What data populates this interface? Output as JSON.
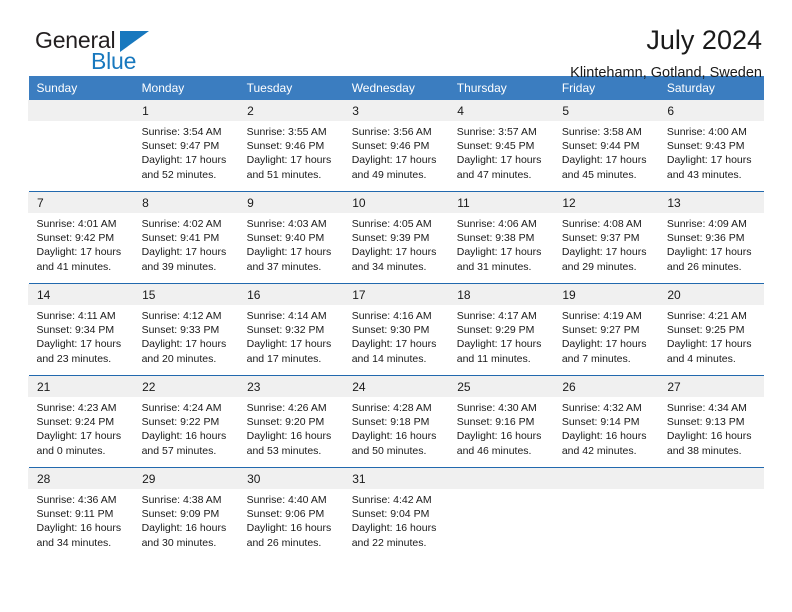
{
  "logo": {
    "word_general": "General",
    "word_blue": "Blue",
    "triangle_color": "#1878be"
  },
  "header": {
    "title": "July 2024",
    "subtitle": "Klintehamn, Gotland, Sweden"
  },
  "theme": {
    "header_bg": "#3b7dc0",
    "week_separator": "#2269ae",
    "daynum_bg": "#f0f0f0",
    "text": "#1a1a1a"
  },
  "weekday_headers": [
    "Sunday",
    "Monday",
    "Tuesday",
    "Wednesday",
    "Thursday",
    "Friday",
    "Saturday"
  ],
  "weeks": [
    {
      "days": [
        {
          "date": "",
          "sunrise": "",
          "sunset": "",
          "daylight_line1": "",
          "daylight_line2": "",
          "empty": true
        },
        {
          "date": "1",
          "sunrise": "Sunrise: 3:54 AM",
          "sunset": "Sunset: 9:47 PM",
          "daylight_line1": "Daylight: 17 hours",
          "daylight_line2": "and 52 minutes."
        },
        {
          "date": "2",
          "sunrise": "Sunrise: 3:55 AM",
          "sunset": "Sunset: 9:46 PM",
          "daylight_line1": "Daylight: 17 hours",
          "daylight_line2": "and 51 minutes."
        },
        {
          "date": "3",
          "sunrise": "Sunrise: 3:56 AM",
          "sunset": "Sunset: 9:46 PM",
          "daylight_line1": "Daylight: 17 hours",
          "daylight_line2": "and 49 minutes."
        },
        {
          "date": "4",
          "sunrise": "Sunrise: 3:57 AM",
          "sunset": "Sunset: 9:45 PM",
          "daylight_line1": "Daylight: 17 hours",
          "daylight_line2": "and 47 minutes."
        },
        {
          "date": "5",
          "sunrise": "Sunrise: 3:58 AM",
          "sunset": "Sunset: 9:44 PM",
          "daylight_line1": "Daylight: 17 hours",
          "daylight_line2": "and 45 minutes."
        },
        {
          "date": "6",
          "sunrise": "Sunrise: 4:00 AM",
          "sunset": "Sunset: 9:43 PM",
          "daylight_line1": "Daylight: 17 hours",
          "daylight_line2": "and 43 minutes."
        }
      ]
    },
    {
      "days": [
        {
          "date": "7",
          "sunrise": "Sunrise: 4:01 AM",
          "sunset": "Sunset: 9:42 PM",
          "daylight_line1": "Daylight: 17 hours",
          "daylight_line2": "and 41 minutes."
        },
        {
          "date": "8",
          "sunrise": "Sunrise: 4:02 AM",
          "sunset": "Sunset: 9:41 PM",
          "daylight_line1": "Daylight: 17 hours",
          "daylight_line2": "and 39 minutes."
        },
        {
          "date": "9",
          "sunrise": "Sunrise: 4:03 AM",
          "sunset": "Sunset: 9:40 PM",
          "daylight_line1": "Daylight: 17 hours",
          "daylight_line2": "and 37 minutes."
        },
        {
          "date": "10",
          "sunrise": "Sunrise: 4:05 AM",
          "sunset": "Sunset: 9:39 PM",
          "daylight_line1": "Daylight: 17 hours",
          "daylight_line2": "and 34 minutes."
        },
        {
          "date": "11",
          "sunrise": "Sunrise: 4:06 AM",
          "sunset": "Sunset: 9:38 PM",
          "daylight_line1": "Daylight: 17 hours",
          "daylight_line2": "and 31 minutes."
        },
        {
          "date": "12",
          "sunrise": "Sunrise: 4:08 AM",
          "sunset": "Sunset: 9:37 PM",
          "daylight_line1": "Daylight: 17 hours",
          "daylight_line2": "and 29 minutes."
        },
        {
          "date": "13",
          "sunrise": "Sunrise: 4:09 AM",
          "sunset": "Sunset: 9:36 PM",
          "daylight_line1": "Daylight: 17 hours",
          "daylight_line2": "and 26 minutes."
        }
      ]
    },
    {
      "days": [
        {
          "date": "14",
          "sunrise": "Sunrise: 4:11 AM",
          "sunset": "Sunset: 9:34 PM",
          "daylight_line1": "Daylight: 17 hours",
          "daylight_line2": "and 23 minutes."
        },
        {
          "date": "15",
          "sunrise": "Sunrise: 4:12 AM",
          "sunset": "Sunset: 9:33 PM",
          "daylight_line1": "Daylight: 17 hours",
          "daylight_line2": "and 20 minutes."
        },
        {
          "date": "16",
          "sunrise": "Sunrise: 4:14 AM",
          "sunset": "Sunset: 9:32 PM",
          "daylight_line1": "Daylight: 17 hours",
          "daylight_line2": "and 17 minutes."
        },
        {
          "date": "17",
          "sunrise": "Sunrise: 4:16 AM",
          "sunset": "Sunset: 9:30 PM",
          "daylight_line1": "Daylight: 17 hours",
          "daylight_line2": "and 14 minutes."
        },
        {
          "date": "18",
          "sunrise": "Sunrise: 4:17 AM",
          "sunset": "Sunset: 9:29 PM",
          "daylight_line1": "Daylight: 17 hours",
          "daylight_line2": "and 11 minutes."
        },
        {
          "date": "19",
          "sunrise": "Sunrise: 4:19 AM",
          "sunset": "Sunset: 9:27 PM",
          "daylight_line1": "Daylight: 17 hours",
          "daylight_line2": "and 7 minutes."
        },
        {
          "date": "20",
          "sunrise": "Sunrise: 4:21 AM",
          "sunset": "Sunset: 9:25 PM",
          "daylight_line1": "Daylight: 17 hours",
          "daylight_line2": "and 4 minutes."
        }
      ]
    },
    {
      "days": [
        {
          "date": "21",
          "sunrise": "Sunrise: 4:23 AM",
          "sunset": "Sunset: 9:24 PM",
          "daylight_line1": "Daylight: 17 hours",
          "daylight_line2": "and 0 minutes."
        },
        {
          "date": "22",
          "sunrise": "Sunrise: 4:24 AM",
          "sunset": "Sunset: 9:22 PM",
          "daylight_line1": "Daylight: 16 hours",
          "daylight_line2": "and 57 minutes."
        },
        {
          "date": "23",
          "sunrise": "Sunrise: 4:26 AM",
          "sunset": "Sunset: 9:20 PM",
          "daylight_line1": "Daylight: 16 hours",
          "daylight_line2": "and 53 minutes."
        },
        {
          "date": "24",
          "sunrise": "Sunrise: 4:28 AM",
          "sunset": "Sunset: 9:18 PM",
          "daylight_line1": "Daylight: 16 hours",
          "daylight_line2": "and 50 minutes."
        },
        {
          "date": "25",
          "sunrise": "Sunrise: 4:30 AM",
          "sunset": "Sunset: 9:16 PM",
          "daylight_line1": "Daylight: 16 hours",
          "daylight_line2": "and 46 minutes."
        },
        {
          "date": "26",
          "sunrise": "Sunrise: 4:32 AM",
          "sunset": "Sunset: 9:14 PM",
          "daylight_line1": "Daylight: 16 hours",
          "daylight_line2": "and 42 minutes."
        },
        {
          "date": "27",
          "sunrise": "Sunrise: 4:34 AM",
          "sunset": "Sunset: 9:13 PM",
          "daylight_line1": "Daylight: 16 hours",
          "daylight_line2": "and 38 minutes."
        }
      ]
    },
    {
      "days": [
        {
          "date": "28",
          "sunrise": "Sunrise: 4:36 AM",
          "sunset": "Sunset: 9:11 PM",
          "daylight_line1": "Daylight: 16 hours",
          "daylight_line2": "and 34 minutes."
        },
        {
          "date": "29",
          "sunrise": "Sunrise: 4:38 AM",
          "sunset": "Sunset: 9:09 PM",
          "daylight_line1": "Daylight: 16 hours",
          "daylight_line2": "and 30 minutes."
        },
        {
          "date": "30",
          "sunrise": "Sunrise: 4:40 AM",
          "sunset": "Sunset: 9:06 PM",
          "daylight_line1": "Daylight: 16 hours",
          "daylight_line2": "and 26 minutes."
        },
        {
          "date": "31",
          "sunrise": "Sunrise: 4:42 AM",
          "sunset": "Sunset: 9:04 PM",
          "daylight_line1": "Daylight: 16 hours",
          "daylight_line2": "and 22 minutes."
        },
        {
          "date": "",
          "sunrise": "",
          "sunset": "",
          "daylight_line1": "",
          "daylight_line2": "",
          "empty": true
        },
        {
          "date": "",
          "sunrise": "",
          "sunset": "",
          "daylight_line1": "",
          "daylight_line2": "",
          "empty": true
        },
        {
          "date": "",
          "sunrise": "",
          "sunset": "",
          "daylight_line1": "",
          "daylight_line2": "",
          "empty": true
        }
      ]
    }
  ]
}
